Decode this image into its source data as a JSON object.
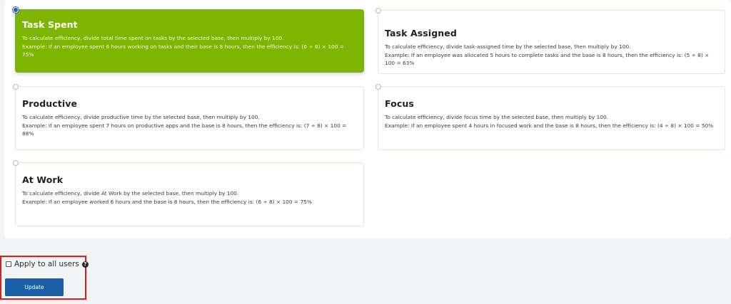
{
  "options": [
    {
      "title": "Task Spent",
      "line1": "To calculate efficiency, divide total time spent on tasks by the selected base, then multiply by 100.",
      "line2": "Example: If an employee spent 6 hours working on tasks and their base is 8 hours, then the efficiency is: (6 ÷ 8) × 100 = 75%",
      "selected": true
    },
    {
      "title": "Task Assigned",
      "line1": "To calculate efficiency, divide task-assigned time by the selected base, then multiply by 100.",
      "line2": "Example: If an employee was allocated 5 hours to complete tasks and the base is 8 hours, then the efficiency is: (5 ÷ 8) × 100 = 63%",
      "selected": false
    },
    {
      "title": "Productive",
      "line1": "To calculate efficiency, divide productive time by the selected base, then multiply by 100.",
      "line2": "Example: If an employee spent 7 hours on productive apps and the base is 8 hours, then the efficiency is: (7 ÷ 8) × 100 = 88%",
      "selected": false
    },
    {
      "title": "Focus",
      "line1": "To calculate efficiency, divide focus time by the selected base, then multiply by 100.",
      "line2": "Example: If an employee spent 4 hours in focused work and the base is 8 hours, then the efficiency is: (4 ÷ 8) × 100 = 50%",
      "selected": false
    },
    {
      "title": "At Work",
      "line1": "To calculate efficiency, divide At Work by the selected base, then multiply by 100.",
      "line2": "Example: If an employee worked 6 hours and the base is 8 hours, then the efficiency is: (6 ÷ 8) × 100 = 75%",
      "selected": false
    }
  ],
  "apply_all": {
    "label": "Apply to all users",
    "checked": false,
    "help_icon": "question-circle-icon"
  },
  "update_button": {
    "label": "Update"
  },
  "colors": {
    "selected_card": "#7db500",
    "primary_button": "#1b5ea8",
    "highlight_border": "#e31b1b"
  }
}
